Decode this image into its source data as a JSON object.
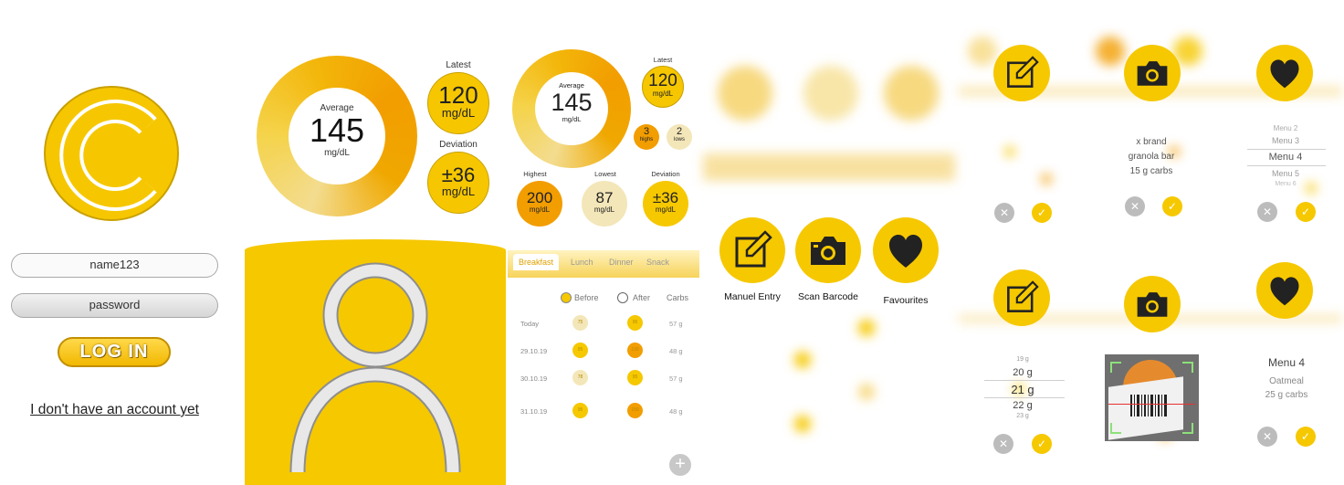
{
  "login": {
    "username": "name123",
    "password_placeholder": "password",
    "login_label": "LOG IN",
    "no_account_link": "I don't have an account yet"
  },
  "summary": {
    "average_label": "Average",
    "average_value": "145",
    "unit": "mg/dL",
    "latest_label": "Latest",
    "latest_value": "120",
    "deviation_label": "Deviation",
    "deviation_value": "±36"
  },
  "stats": {
    "average_label": "Average",
    "average_value": "145",
    "unit": "mg/dL",
    "latest_label": "Latest",
    "latest_value": "120",
    "highs_value": "3",
    "highs_label": "highs",
    "lows_value": "2",
    "lows_label": "lows",
    "highest_label": "Highest",
    "highest_value": "200",
    "lowest_label": "Lowest",
    "lowest_value": "87",
    "deviation_label": "Deviation",
    "deviation_value": "±36"
  },
  "log_table": {
    "tabs": [
      "Breakfast",
      "Lunch",
      "Dinner",
      "Snack"
    ],
    "active_tab": "Breakfast",
    "before_label": "Before",
    "after_label": "After",
    "carbs_label": "Carbs",
    "rows": [
      {
        "date": "Today",
        "before": "75",
        "after": "95",
        "carbs": "57 g"
      },
      {
        "date": "29.10.19",
        "before": "95",
        "after": "130",
        "carbs": "48 g"
      },
      {
        "date": "30.10.19",
        "before": "78",
        "after": "95",
        "carbs": "57 g"
      },
      {
        "date": "31.10.19",
        "before": "95",
        "after": "150",
        "carbs": "48 g"
      }
    ],
    "add_label": "+"
  },
  "add_menu": {
    "manual_entry": "Manuel Entry",
    "scan_barcode": "Scan Barcode",
    "favourites": "Favourites"
  },
  "barcode_result": {
    "brand": "x brand",
    "product": "granola bar",
    "carbs": "15 g carbs"
  },
  "menu_picker": {
    "items": [
      "Menu 2",
      "Menu 3",
      "Menu 4",
      "Menu 5",
      "Menu 6"
    ],
    "selected": "Menu 4"
  },
  "gram_picker": {
    "items": [
      "19 g",
      "20 g",
      "21 g",
      "22 g",
      "23 g"
    ],
    "selected": "21 g"
  },
  "favourite_detail": {
    "title": "Menu 4",
    "food": "Oatmeal",
    "carbs": "25 g carbs"
  },
  "colors": {
    "accent": "#f6c800",
    "orange": "#f29d00",
    "pale": "#f3e6b8",
    "gray": "#bcbcbc"
  }
}
